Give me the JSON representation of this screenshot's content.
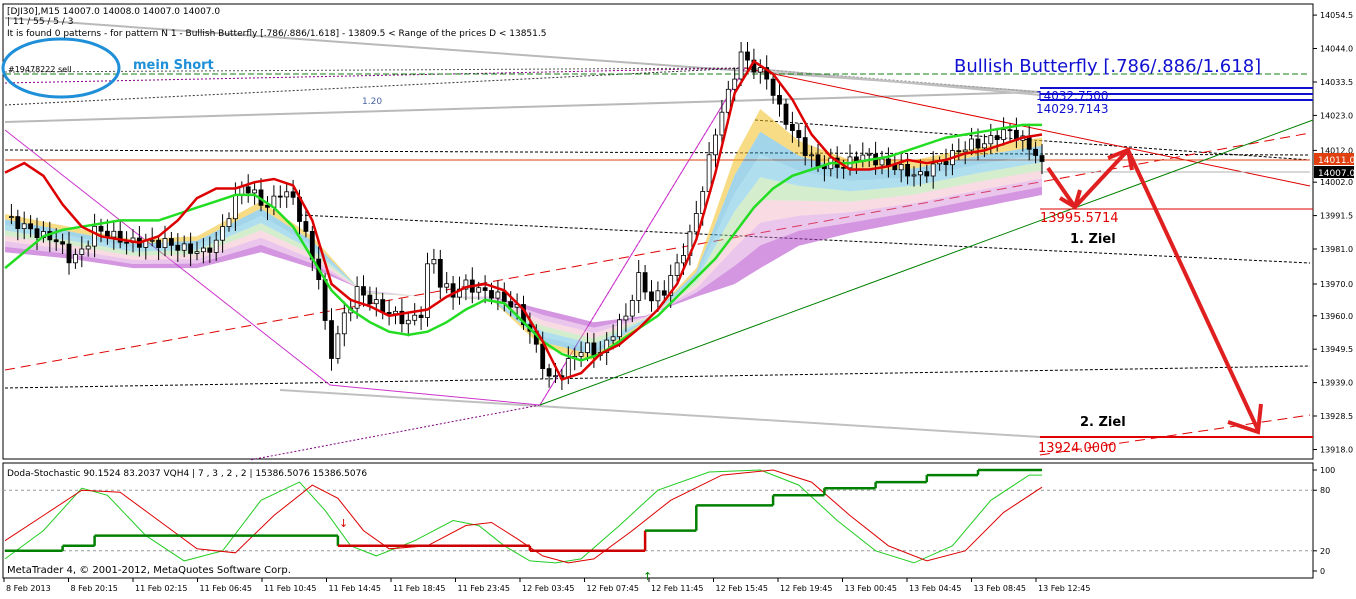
{
  "header": {
    "line1": "[DJI30],M15  14007.0 14008.0 14007.0 14007.0",
    "line2": "| 11 / 55 / 5 / 3",
    "line3": "It is found 0 patterns  -  for pattern N 1 - Bullish Butterfly [.786/.886/1.618]  - 13809.5 < Range of the prices D < 13851.5"
  },
  "order_label": "#19478222 sell",
  "fib_label": "1.20",
  "annotations": {
    "mein_short": "mein Short",
    "pattern_title": "Bullish Butterfly [.786/.886/1.618]",
    "ziel1": "1. Ziel",
    "ziel2": "2. Ziel"
  },
  "levels": {
    "lvl_a": "14032.7500",
    "lvl_b": "14029.7143",
    "lvl_c": "13995.5714",
    "lvl_d": "13924.0000"
  },
  "price_axis": {
    "ticks": [
      "14054.5",
      "14044.0",
      "14033.5",
      "14023.0",
      "14012.0",
      "14002.0",
      "13991.5",
      "13981.0",
      "13970.0",
      "13960.0",
      "13949.5",
      "13939.0",
      "13928.5",
      "13918.0"
    ],
    "tag_red": "14011.0",
    "tag_black": "14007.0"
  },
  "indicator": {
    "label": "Doda-Stochastic 90.1524 83.2037  VQH4  |  7 , 3 , 2 , 2  |  15386.5076  15386.5076",
    "ticks": [
      "100",
      "80",
      "20",
      "0"
    ]
  },
  "footer": {
    "copyright": "MetaTrader 4, © 2001-2012, MetaQuotes Software Corp."
  },
  "time_axis": [
    "8 Feb 2013",
    "8 Feb 20:15",
    "11 Feb 02:15",
    "11 Feb 06:45",
    "11 Feb 10:45",
    "11 Feb 14:45",
    "11 Feb 18:45",
    "11 Feb 23:45",
    "12 Feb 03:45",
    "12 Feb 07:45",
    "12 Feb 11:45",
    "12 Feb 15:45",
    "12 Feb 19:45",
    "13 Feb 00:45",
    "13 Feb 04:45",
    "13 Feb 08:45",
    "13 Feb 12:45"
  ],
  "colors": {
    "bull_title": "#1010d0",
    "level_red": "#e00000",
    "ma_green": "#22dd22",
    "ma_red": "#dd0000",
    "trend_green": "#008000",
    "ellipse_blue": "#1f8fd8",
    "ribbon_purple": "#b040c8",
    "ribbon_teal": "#30b0d0",
    "ribbon_yellow": "#f0c020"
  },
  "chart_data": {
    "type": "candlestick",
    "symbol": "DJI30",
    "timeframe": "M15",
    "last_ohlc": {
      "open": 14007.0,
      "high": 14008.0,
      "low": 14007.0,
      "close": 14007.0
    },
    "ylim": [
      13915,
      14058
    ],
    "close_path": [
      [
        0,
        13991
      ],
      [
        3,
        13988
      ],
      [
        6,
        13985
      ],
      [
        8,
        13984
      ],
      [
        10,
        13978
      ],
      [
        12,
        13980
      ],
      [
        14,
        13987
      ],
      [
        16,
        13986
      ],
      [
        18,
        13984
      ],
      [
        20,
        13983
      ],
      [
        22,
        13983
      ],
      [
        25,
        13983
      ],
      [
        28,
        13981
      ],
      [
        31,
        13980
      ],
      [
        33,
        13983
      ],
      [
        35,
        13992
      ],
      [
        37,
        14001
      ],
      [
        39,
        13998
      ],
      [
        41,
        13994
      ],
      [
        43,
        13999
      ],
      [
        45,
        13997
      ],
      [
        47,
        13985
      ],
      [
        49,
        13972
      ],
      [
        50,
        13957
      ],
      [
        51,
        13948
      ],
      [
        53,
        13960
      ],
      [
        55,
        13968
      ],
      [
        57,
        13965
      ],
      [
        59,
        13962
      ],
      [
        61,
        13960
      ],
      [
        63,
        13958
      ],
      [
        65,
        13961
      ],
      [
        66,
        13975
      ],
      [
        67,
        13978
      ],
      [
        68,
        13970
      ],
      [
        70,
        13967
      ],
      [
        72,
        13970
      ],
      [
        74,
        13968
      ],
      [
        76,
        13967
      ],
      [
        78,
        13965
      ],
      [
        80,
        13962
      ],
      [
        82,
        13955
      ],
      [
        84,
        13945
      ],
      [
        85,
        13940
      ],
      [
        87,
        13942
      ],
      [
        89,
        13948
      ],
      [
        91,
        13950
      ],
      [
        93,
        13948
      ],
      [
        95,
        13955
      ],
      [
        97,
        13960
      ],
      [
        99,
        13972
      ],
      [
        101,
        13965
      ],
      [
        103,
        13968
      ],
      [
        105,
        13976
      ],
      [
        107,
        13985
      ],
      [
        109,
        14000
      ],
      [
        111,
        14018
      ],
      [
        113,
        14030
      ],
      [
        115,
        14042
      ],
      [
        117,
        14038
      ],
      [
        119,
        14035
      ],
      [
        121,
        14025
      ],
      [
        123,
        14018
      ],
      [
        125,
        14012
      ],
      [
        127,
        14007
      ],
      [
        129,
        14008
      ],
      [
        131,
        14007
      ],
      [
        133,
        14010
      ],
      [
        135,
        14010
      ],
      [
        137,
        14008
      ],
      [
        139,
        14007
      ],
      [
        141,
        14005
      ],
      [
        143,
        14004
      ],
      [
        145,
        14007
      ],
      [
        147,
        14009
      ],
      [
        149,
        14012
      ],
      [
        151,
        14014
      ],
      [
        153,
        14014
      ],
      [
        155,
        14017
      ],
      [
        157,
        14018
      ],
      [
        159,
        14015
      ],
      [
        161,
        14011
      ],
      [
        162,
        14007
      ]
    ],
    "red_ma": [
      [
        0,
        14005
      ],
      [
        3,
        14008
      ],
      [
        6,
        14004
      ],
      [
        9,
        13995
      ],
      [
        12,
        13988
      ],
      [
        15,
        13985
      ],
      [
        18,
        13984
      ],
      [
        21,
        13983
      ],
      [
        24,
        13985
      ],
      [
        27,
        13990
      ],
      [
        30,
        13997
      ],
      [
        33,
        14000
      ],
      [
        36,
        14000
      ],
      [
        39,
        14002
      ],
      [
        42,
        14003
      ],
      [
        45,
        14001
      ],
      [
        48,
        13990
      ],
      [
        51,
        13970
      ],
      [
        54,
        13965
      ],
      [
        57,
        13963
      ],
      [
        60,
        13960
      ],
      [
        63,
        13961
      ],
      [
        66,
        13962
      ],
      [
        69,
        13966
      ],
      [
        72,
        13969
      ],
      [
        75,
        13970
      ],
      [
        78,
        13968
      ],
      [
        81,
        13962
      ],
      [
        84,
        13952
      ],
      [
        87,
        13940
      ],
      [
        90,
        13942
      ],
      [
        93,
        13948
      ],
      [
        96,
        13951
      ],
      [
        99,
        13956
      ],
      [
        102,
        13962
      ],
      [
        105,
        13970
      ],
      [
        108,
        13984
      ],
      [
        111,
        14005
      ],
      [
        114,
        14030
      ],
      [
        117,
        14040
      ],
      [
        120,
        14036
      ],
      [
        123,
        14028
      ],
      [
        126,
        14017
      ],
      [
        129,
        14010
      ],
      [
        132,
        14006
      ],
      [
        135,
        14006
      ],
      [
        138,
        14007
      ],
      [
        141,
        14009
      ],
      [
        144,
        14008
      ],
      [
        147,
        14009
      ],
      [
        150,
        14011
      ],
      [
        153,
        14012
      ],
      [
        156,
        14014
      ],
      [
        159,
        14016
      ],
      [
        162,
        14017
      ]
    ],
    "green_ma": [
      [
        0,
        13975
      ],
      [
        3,
        13980
      ],
      [
        6,
        13985
      ],
      [
        9,
        13987
      ],
      [
        12,
        13988
      ],
      [
        15,
        13989
      ],
      [
        18,
        13990
      ],
      [
        21,
        13990
      ],
      [
        24,
        13990
      ],
      [
        27,
        13992
      ],
      [
        30,
        13994
      ],
      [
        33,
        13996
      ],
      [
        36,
        13998
      ],
      [
        39,
        13998
      ],
      [
        42,
        13994
      ],
      [
        45,
        13988
      ],
      [
        48,
        13978
      ],
      [
        51,
        13968
      ],
      [
        54,
        13962
      ],
      [
        57,
        13958
      ],
      [
        60,
        13955
      ],
      [
        63,
        13954
      ],
      [
        66,
        13955
      ],
      [
        69,
        13958
      ],
      [
        72,
        13962
      ],
      [
        75,
        13965
      ],
      [
        78,
        13964
      ],
      [
        81,
        13958
      ],
      [
        84,
        13952
      ],
      [
        87,
        13948
      ],
      [
        90,
        13946
      ],
      [
        93,
        13948
      ],
      [
        96,
        13952
      ],
      [
        99,
        13956
      ],
      [
        102,
        13960
      ],
      [
        105,
        13966
      ],
      [
        108,
        13972
      ],
      [
        111,
        13978
      ],
      [
        114,
        13986
      ],
      [
        117,
        13994
      ],
      [
        120,
        14000
      ],
      [
        123,
        14004
      ],
      [
        126,
        14006
      ],
      [
        129,
        14008
      ],
      [
        132,
        14008
      ],
      [
        135,
        14009
      ],
      [
        138,
        14010
      ],
      [
        141,
        14012
      ],
      [
        144,
        14014
      ],
      [
        147,
        14016
      ],
      [
        150,
        14017
      ],
      [
        153,
        14018
      ],
      [
        156,
        14019
      ],
      [
        159,
        14020
      ],
      [
        162,
        14020
      ]
    ],
    "ribbon_top": [
      [
        0,
        13992
      ],
      [
        10,
        13988
      ],
      [
        20,
        13984
      ],
      [
        30,
        13985
      ],
      [
        40,
        13996
      ],
      [
        48,
        13985
      ],
      [
        56,
        13967
      ],
      [
        66,
        13966
      ],
      [
        76,
        13965
      ],
      [
        84,
        13950
      ],
      [
        92,
        13946
      ],
      [
        100,
        13958
      ],
      [
        108,
        13975
      ],
      [
        114,
        14010
      ],
      [
        118,
        14025
      ],
      [
        124,
        14015
      ],
      [
        132,
        14009
      ],
      [
        142,
        14009
      ],
      [
        152,
        14013
      ],
      [
        162,
        14016
      ]
    ],
    "ribbon_bottom": [
      [
        0,
        13980
      ],
      [
        10,
        13978
      ],
      [
        20,
        13975
      ],
      [
        30,
        13975
      ],
      [
        40,
        13980
      ],
      [
        48,
        13975
      ],
      [
        56,
        13968
      ],
      [
        66,
        13966
      ],
      [
        76,
        13966
      ],
      [
        84,
        13962
      ],
      [
        92,
        13958
      ],
      [
        100,
        13960
      ],
      [
        108,
        13966
      ],
      [
        114,
        13970
      ],
      [
        118,
        13975
      ],
      [
        124,
        13982
      ],
      [
        132,
        13986
      ],
      [
        142,
        13990
      ],
      [
        152,
        13994
      ],
      [
        162,
        13998
      ]
    ],
    "stoch_green": [
      [
        0,
        12
      ],
      [
        6,
        40
      ],
      [
        12,
        82
      ],
      [
        16,
        75
      ],
      [
        22,
        35
      ],
      [
        28,
        10
      ],
      [
        34,
        20
      ],
      [
        40,
        70
      ],
      [
        46,
        88
      ],
      [
        50,
        60
      ],
      [
        54,
        25
      ],
      [
        58,
        15
      ],
      [
        64,
        30
      ],
      [
        70,
        50
      ],
      [
        74,
        45
      ],
      [
        78,
        25
      ],
      [
        82,
        10
      ],
      [
        86,
        8
      ],
      [
        90,
        12
      ],
      [
        96,
        45
      ],
      [
        102,
        80
      ],
      [
        110,
        98
      ],
      [
        118,
        100
      ],
      [
        124,
        85
      ],
      [
        130,
        50
      ],
      [
        136,
        20
      ],
      [
        142,
        8
      ],
      [
        148,
        25
      ],
      [
        154,
        70
      ],
      [
        160,
        95
      ],
      [
        162,
        95
      ]
    ],
    "stoch_red": [
      [
        0,
        30
      ],
      [
        6,
        55
      ],
      [
        12,
        80
      ],
      [
        18,
        78
      ],
      [
        24,
        50
      ],
      [
        30,
        22
      ],
      [
        36,
        18
      ],
      [
        42,
        55
      ],
      [
        48,
        85
      ],
      [
        52,
        72
      ],
      [
        56,
        40
      ],
      [
        60,
        22
      ],
      [
        66,
        25
      ],
      [
        72,
        45
      ],
      [
        76,
        48
      ],
      [
        80,
        32
      ],
      [
        84,
        15
      ],
      [
        88,
        8
      ],
      [
        92,
        12
      ],
      [
        98,
        40
      ],
      [
        104,
        70
      ],
      [
        112,
        95
      ],
      [
        120,
        100
      ],
      [
        126,
        88
      ],
      [
        132,
        55
      ],
      [
        138,
        25
      ],
      [
        144,
        10
      ],
      [
        150,
        20
      ],
      [
        156,
        58
      ],
      [
        162,
        83
      ]
    ],
    "stoch_signal": [
      [
        0,
        20
      ],
      [
        9,
        20
      ],
      [
        9,
        25
      ],
      [
        14,
        25
      ],
      [
        14,
        35
      ],
      [
        52,
        35
      ],
      [
        52,
        25
      ],
      [
        82,
        25
      ],
      [
        82,
        20
      ],
      [
        100,
        20
      ],
      [
        100,
        40
      ],
      [
        108,
        40
      ],
      [
        108,
        65
      ],
      [
        120,
        65
      ],
      [
        120,
        75
      ],
      [
        128,
        75
      ],
      [
        128,
        82
      ],
      [
        136,
        82
      ],
      [
        136,
        88
      ],
      [
        144,
        88
      ],
      [
        144,
        95
      ],
      [
        152,
        95
      ],
      [
        152,
        100
      ],
      [
        162,
        100
      ]
    ]
  }
}
